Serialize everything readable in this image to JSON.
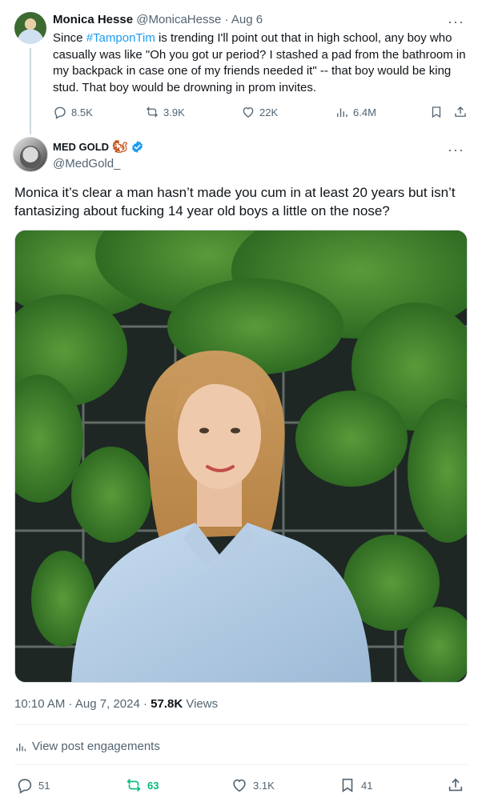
{
  "quoted": {
    "author_name": "Monica Hesse",
    "author_handle": "@MonicaHesse",
    "separator": "·",
    "date": "Aug 6",
    "text_before": "Since ",
    "hashtag": "#TamponTim",
    "text_after": " is trending I'll point out that in high school, any boy who casually was like \"Oh you got ur period? I stashed a pad from the bathroom in my backpack in case one of my friends needed it\" -- that boy would be king stud. That boy would be drowning in prom invites.",
    "stats": {
      "replies": "8.5K",
      "reposts": "3.9K",
      "likes": "22K",
      "views": "6.4M"
    }
  },
  "post": {
    "author_name": "MED GOLD",
    "author_emoji": "🐿",
    "author_handle": "@MedGold_",
    "text": "Monica it’s clear a man hasn’t made you cum in at least 20 years but isn’t fantasizing about fucking 14 year old boys a little on the nose?",
    "time": "10:10 AM",
    "date_sep": " · ",
    "date": "Aug 7, 2024",
    "views_sep": " · ",
    "views_count": "57.8K",
    "views_label": " Views",
    "engagements_label": "View post engagements",
    "stats": {
      "replies": "51",
      "reposts": "63",
      "likes": "3.1K",
      "bookmarks": "41"
    }
  },
  "more_glyph": "···",
  "colors": {
    "accent": "#1d9bf0",
    "repost_active": "#00ba7c",
    "muted": "#536471"
  }
}
